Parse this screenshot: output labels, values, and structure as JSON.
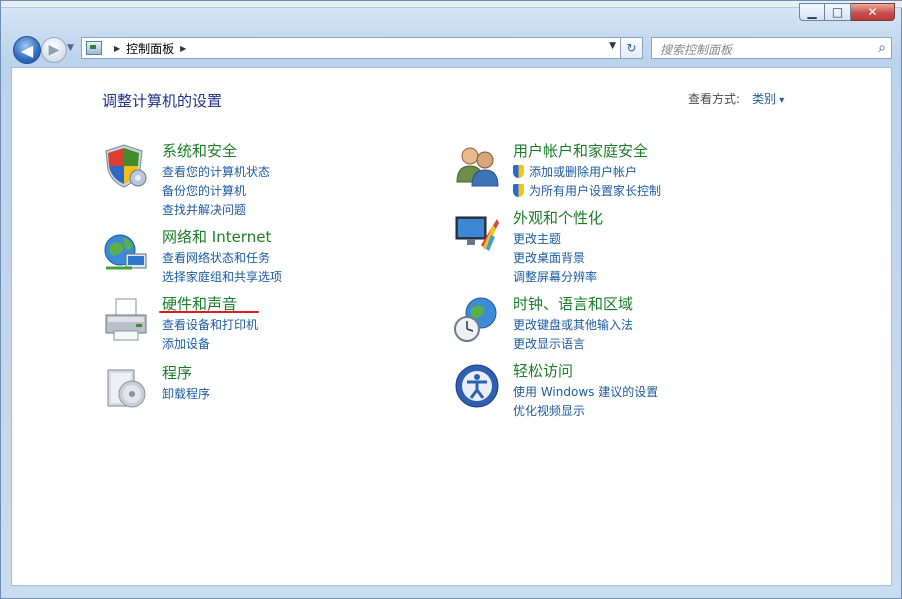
{
  "window": {
    "min_icon": "minimize-icon",
    "max_icon": "maximize-icon",
    "close_icon": "close-icon"
  },
  "nav": {
    "address_root": "控制面板",
    "search_placeholder": "搜索控制面板"
  },
  "header": {
    "title": "调整计算机的设置",
    "view_by_label": "查看方式:",
    "view_by_value": "类别"
  },
  "categories": [
    {
      "title": "系统和安全",
      "icon": "shield-icon",
      "links": [
        "查看您的计算机状态",
        "备份您的计算机",
        "查找并解决问题"
      ]
    },
    {
      "title": "网络和 Internet",
      "icon": "network-globe-icon",
      "links": [
        "查看网络状态和任务",
        "选择家庭组和共享选项"
      ]
    },
    {
      "title": "硬件和声音",
      "icon": "printer-icon",
      "links": [
        "查看设备和打印机",
        "添加设备"
      ]
    },
    {
      "title": "程序",
      "icon": "programs-disc-icon",
      "links": [
        "卸载程序"
      ]
    },
    {
      "title": "用户帐户和家庭安全",
      "icon": "users-icon",
      "links": [
        "添加或删除用户帐户",
        "为所有用户设置家长控制"
      ]
    },
    {
      "title": "外观和个性化",
      "icon": "monitor-palette-icon",
      "links": [
        "更改主题",
        "更改桌面背景",
        "调整屏幕分辨率"
      ]
    },
    {
      "title": "时钟、语言和区域",
      "icon": "globe-clock-icon",
      "links": [
        "更改键盘或其他输入法",
        "更改显示语言"
      ]
    },
    {
      "title": "轻松访问",
      "icon": "ease-of-access-icon",
      "links": [
        "使用 Windows 建议的设置",
        "优化视频显示"
      ]
    }
  ],
  "colors": {
    "category_title": "#1a7d28",
    "link": "#1e5ba0",
    "page_title": "#1e3287",
    "highlight_underline": "#d42020"
  }
}
